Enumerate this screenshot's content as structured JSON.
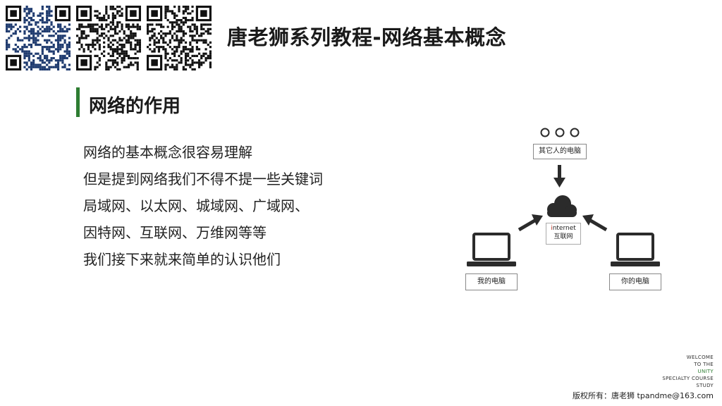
{
  "header": {
    "title": "唐老狮系列教程-网络基本概念",
    "qr_codes": [
      "qr-code-1",
      "qr-code-2",
      "qr-code-3"
    ]
  },
  "section": {
    "title": "网络的作用",
    "bar_color": "#2e7d32"
  },
  "bullets": [
    "网络的基本概念很容易理解",
    "但是提到网络我们不得不提一些关键词",
    "局域网、以太网、城域网、广域网、",
    "因特网、互联网、万维网等等",
    "我们接下来就来简单的认识他们"
  ],
  "diagram": {
    "others_label": "其它人的电脑",
    "mine_label": "我的电脑",
    "yours_label": "你的电脑",
    "internet_first_letter": "i",
    "internet_rest": "nternet",
    "internet_cn": "互联网",
    "icons": [
      "dots-icon",
      "cloud-icon",
      "laptop-icon",
      "arrow-icon"
    ]
  },
  "footer": {
    "study_lines": [
      "WELCOME",
      "TO THE",
      "UNITY",
      "SPECIALTY COURSE",
      "STUDY"
    ],
    "copyright": "版权所有：唐老狮 tpandme@163.com"
  },
  "colors": {
    "accent": "#2e7d32",
    "icon": "#2b2b2b",
    "internet_i": "#c0392b"
  }
}
